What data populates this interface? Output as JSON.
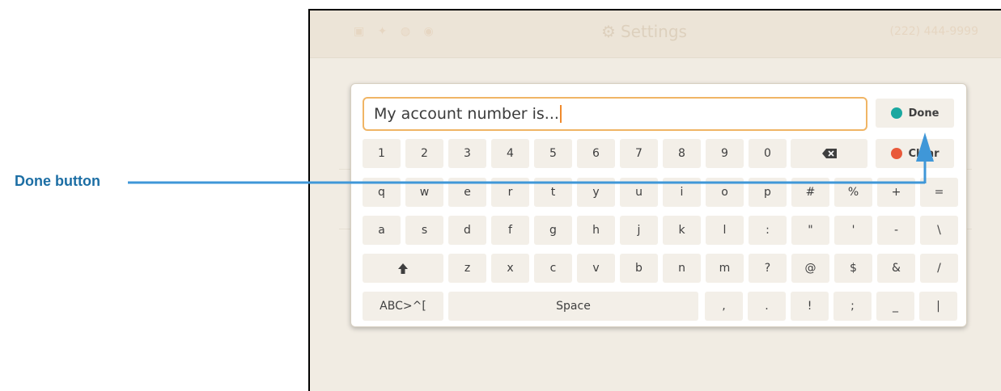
{
  "annotation": {
    "label": "Done button"
  },
  "screen": {
    "topbar": {
      "status_icons": "▣ ✦ ◍ ◉",
      "title": "Settings",
      "phone": "(222) 444-9999"
    }
  },
  "keyboard": {
    "input": {
      "value": "My account number is..."
    },
    "actions": {
      "done": "Done",
      "clear": "Clear"
    },
    "rows": [
      [
        "1",
        "2",
        "3",
        "4",
        "5",
        "6",
        "7",
        "8",
        "9",
        "0"
      ],
      [
        "q",
        "w",
        "e",
        "r",
        "t",
        "y",
        "u",
        "i",
        "o",
        "p",
        "#",
        "%",
        "+",
        "="
      ],
      [
        "a",
        "s",
        "d",
        "f",
        "g",
        "h",
        "j",
        "k",
        "l",
        ":",
        "\"",
        "'",
        "-",
        "\\"
      ],
      [
        "z",
        "x",
        "c",
        "v",
        "b",
        "n",
        "m",
        "?",
        "@",
        "$",
        "&",
        "/"
      ],
      [
        ",",
        ".",
        "!",
        ";",
        "_",
        "|"
      ]
    ],
    "special": {
      "shift_icon": "shift-up-arrow",
      "backspace_icon": "backspace-icon",
      "mode": "ABC>^[",
      "space": "Space"
    }
  },
  "colors": {
    "accent_orange": "#f0b565",
    "done_dot": "#1aa8a0",
    "clear_dot": "#e9593a",
    "annotation": "#1c6ea4"
  }
}
